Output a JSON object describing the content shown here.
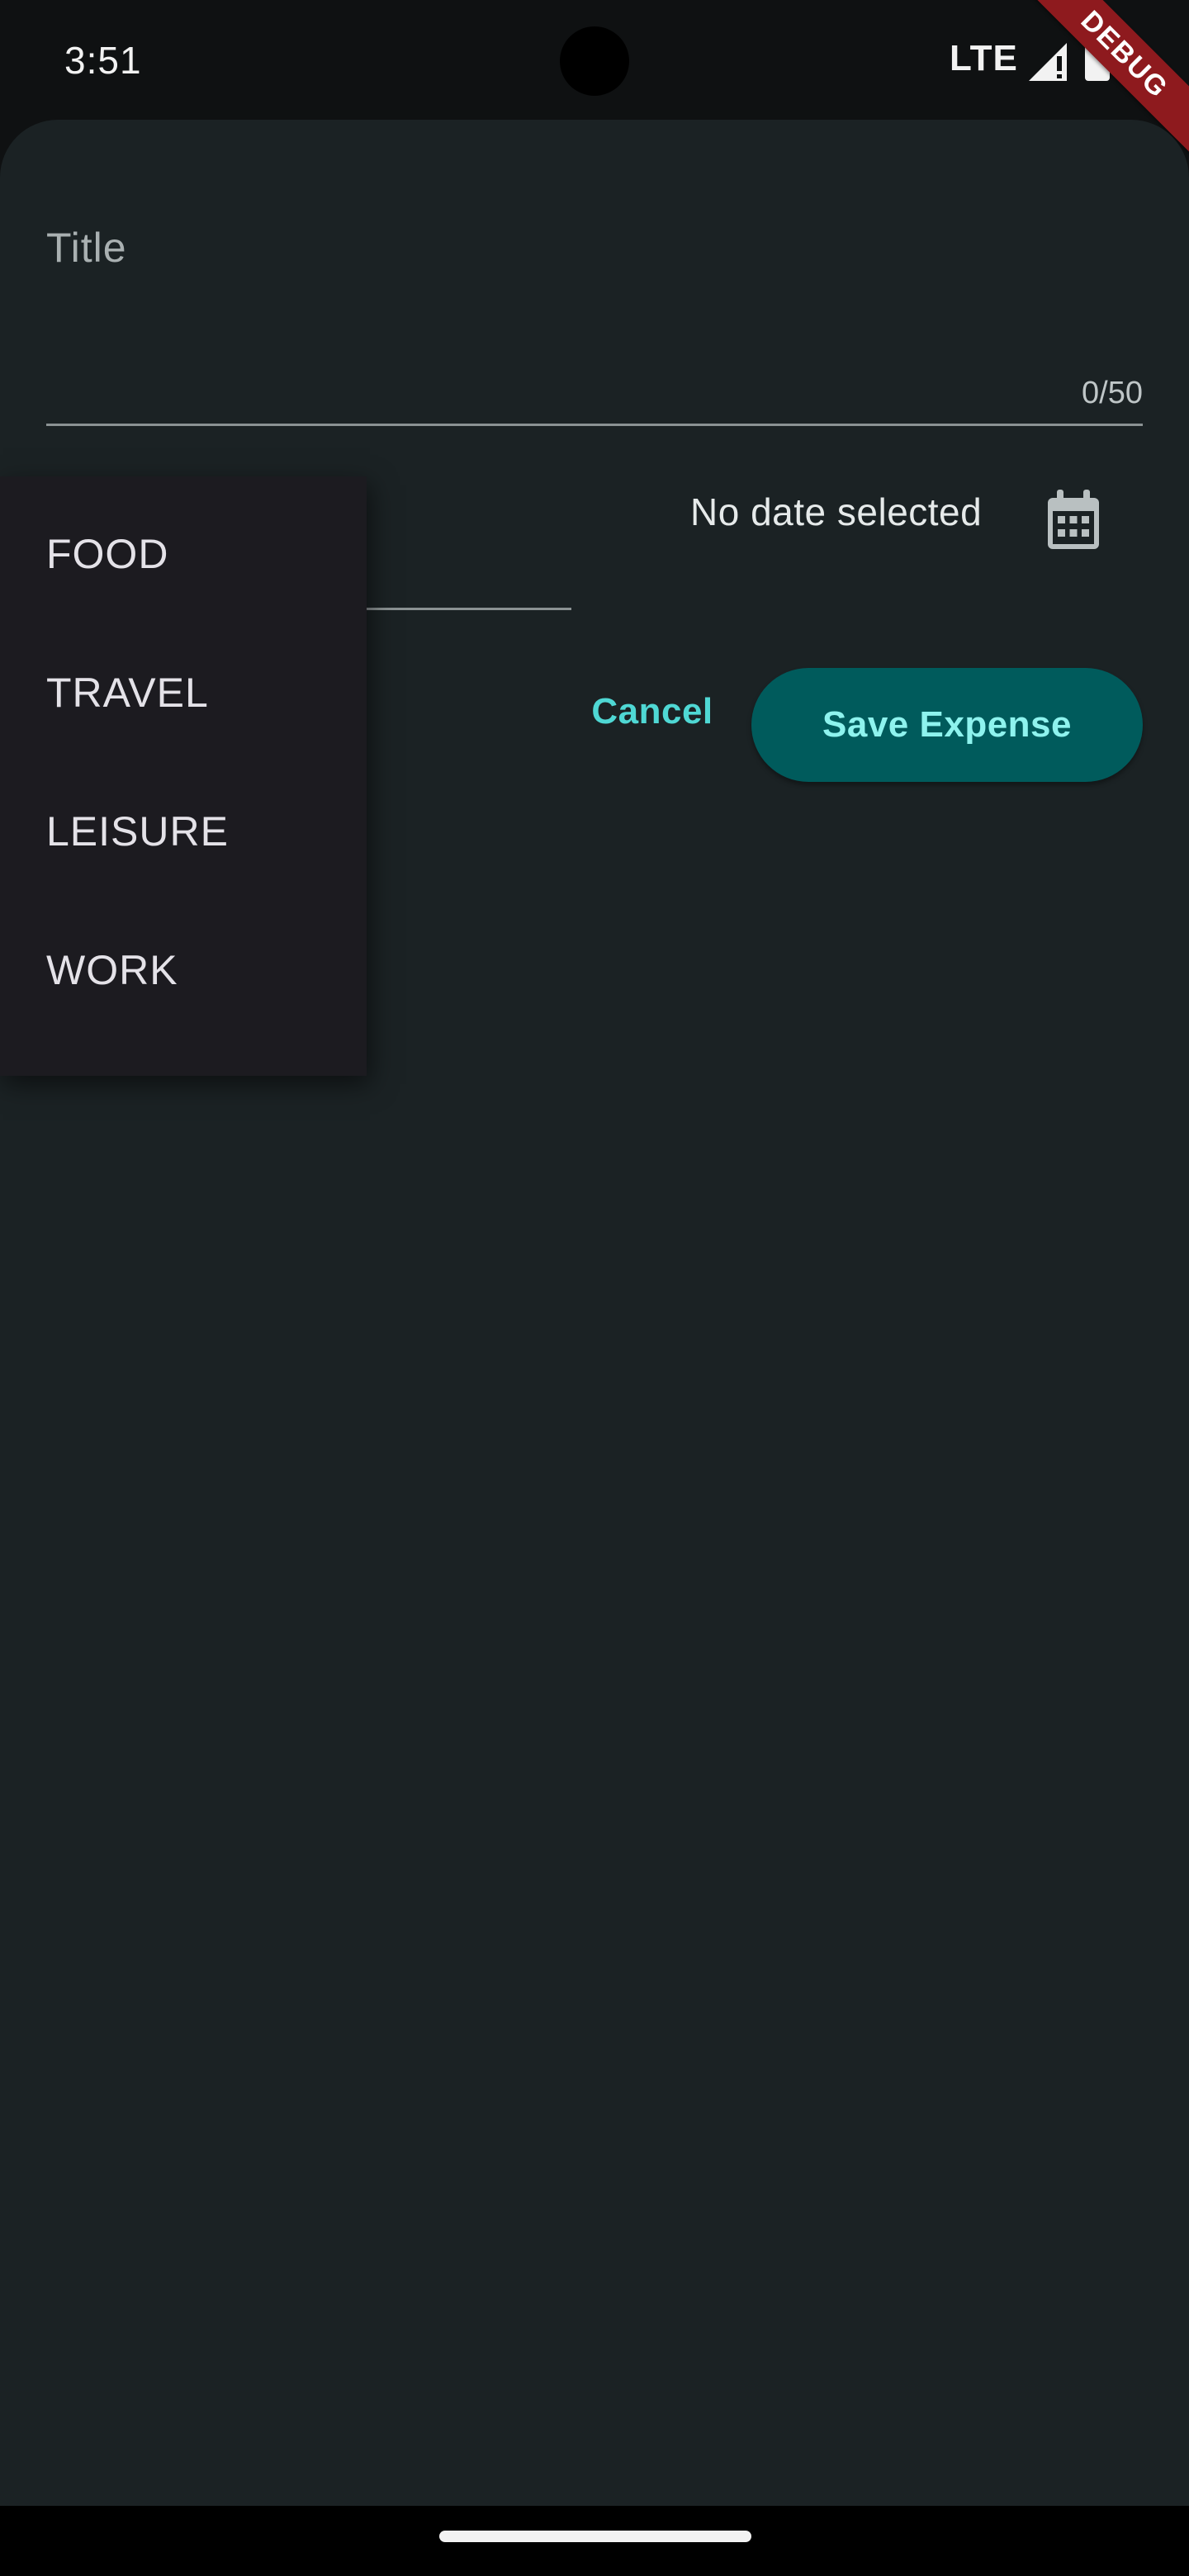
{
  "status_bar": {
    "time": "3:51",
    "network": "LTE",
    "debug_banner": "DEBUG"
  },
  "form": {
    "title_placeholder": "Title",
    "title_value": "",
    "char_counter": "0/50",
    "date_text": "No date selected",
    "cancel_label": "Cancel",
    "save_label": "Save Expense"
  },
  "category_dropdown": {
    "items": [
      {
        "label": "FOOD"
      },
      {
        "label": "TRAVEL"
      },
      {
        "label": "LEISURE"
      },
      {
        "label": "WORK"
      }
    ]
  },
  "icons": {
    "calendar": "calendar-icon",
    "signal": "cell-signal-icon",
    "battery": "battery-icon"
  },
  "colors": {
    "sheet_background": "#1b2224",
    "accent_text": "#4fd8d4",
    "primary_button_bg": "#005b5c",
    "primary_button_text": "#8ef3ee",
    "debug_ribbon": "#8e1a1e",
    "menu_background": "#1c1b20"
  }
}
